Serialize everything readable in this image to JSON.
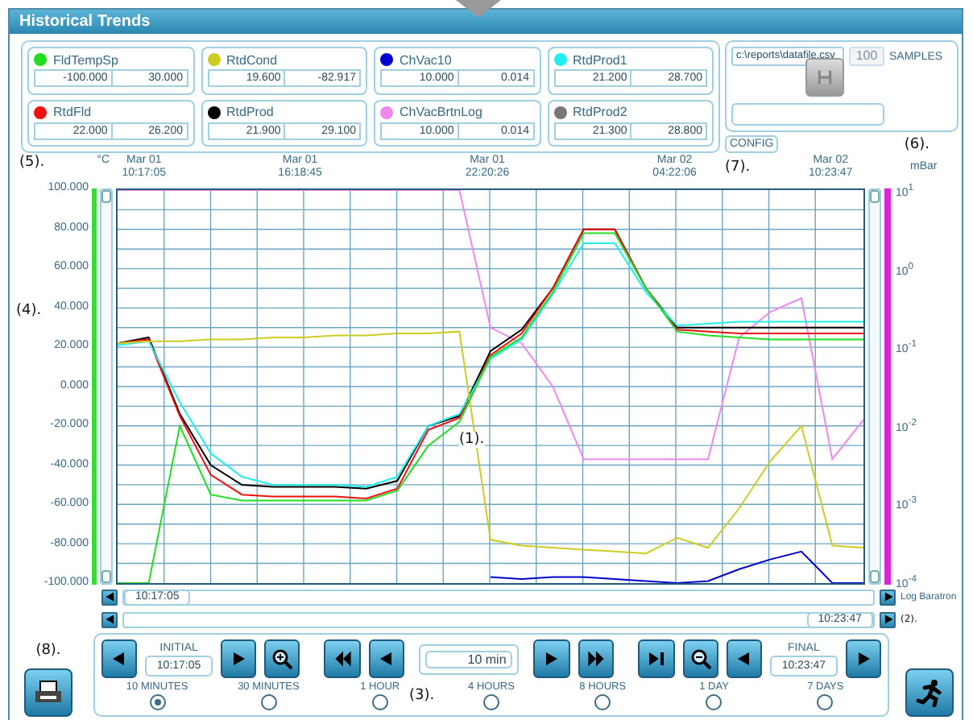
{
  "window": {
    "title": "Historical Trends"
  },
  "tags": [
    {
      "min": "-100.000",
      "max": "30.000"
    },
    {
      "min": "19.600",
      "max": "-82.917"
    },
    {
      "min": "10.000",
      "max": "0.014"
    },
    {
      "min": "21.200",
      "max": "28.700"
    },
    {
      "min": "22.000",
      "max": "26.200"
    },
    {
      "min": "21.900",
      "max": "29.100"
    },
    {
      "min": "10.000",
      "max": "0.014"
    },
    {
      "min": "21.300",
      "max": "28.800"
    }
  ],
  "export": {
    "file": "c:\\reports\\datafile.csv",
    "samples": "100",
    "samples_label": "SAMPLES",
    "samples_disabled": true,
    "save_disabled": true
  },
  "config_button": "CONFIG",
  "callouts": {
    "c1": "(1).",
    "c2": "(2).",
    "c3": "(3).",
    "c4": "(4).",
    "c5": "(5).",
    "c6": "(6).",
    "c7": "(7).",
    "c8": "(8)."
  },
  "chart": {
    "left_unit": "°C",
    "right_unit": "mBar",
    "chart_data": {
      "type": "line",
      "categories": [
        null,
        "Mar 01 10:17:05",
        null,
        null,
        null,
        null,
        "Mar 01 16:18:45",
        null,
        null,
        null,
        null,
        null,
        "Mar 01 22:20:26",
        null,
        null,
        null,
        null,
        null,
        "Mar 02 04:22:06",
        null,
        null,
        null,
        null,
        "Mar 02 10:23:47",
        null
      ],
      "ylim": [
        -100,
        100
      ],
      "grid": true,
      "yticks": [
        {
          "value": 100,
          "label": "100.000"
        },
        {
          "value": 80,
          "label": "80.000"
        },
        {
          "value": 60,
          "label": "60.000"
        },
        {
          "value": 40,
          "label": "40.000"
        },
        {
          "value": 20,
          "label": "20.000"
        },
        {
          "value": 0,
          "label": "0.000"
        },
        {
          "value": -20,
          "label": "-20.000"
        },
        {
          "value": -40,
          "label": "-40.000"
        },
        {
          "value": -60,
          "label": "-60.000"
        },
        {
          "value": -80,
          "label": "-80.000"
        },
        {
          "value": -100,
          "label": "-100.000"
        }
      ],
      "series": [
        {
          "name": "FldTempSp",
          "color": "#22dd22",
          "values": [
            -100,
            -100,
            -20,
            -55,
            -58,
            -58,
            -58,
            -58,
            -58,
            -53,
            -30,
            -18,
            15,
            25,
            48,
            78,
            78,
            50,
            28,
            26,
            25,
            24,
            24,
            24,
            24
          ]
        },
        {
          "name": "RtdCond",
          "color": "#cccc22",
          "values": [
            22,
            23,
            23,
            24,
            24,
            25,
            25,
            26,
            26,
            27,
            27,
            28,
            -78,
            -81,
            -82,
            -83,
            -84,
            -85,
            -77,
            -82,
            -62,
            -38,
            -20,
            -81,
            -82
          ]
        },
        {
          "name": "ChVac10",
          "color": "#0000cc",
          "values": [
            null,
            null,
            null,
            null,
            null,
            null,
            null,
            null,
            null,
            null,
            null,
            null,
            -97,
            -98,
            -97,
            -97,
            -98,
            -99,
            -100,
            -99,
            -93,
            -88,
            -84,
            -100,
            -100
          ]
        },
        {
          "name": "RtdProd1",
          "color": "#22eeee",
          "values": [
            21,
            23,
            -8,
            -34,
            -46,
            -50,
            -50,
            -50,
            -51,
            -46,
            -20,
            -14,
            14,
            24,
            47,
            73,
            73,
            48,
            31,
            32,
            33,
            33,
            33,
            33,
            33
          ]
        },
        {
          "name": "RtdFld",
          "color": "#ee1111",
          "values": [
            22,
            24,
            -15,
            -45,
            -55,
            -56,
            -56,
            -56,
            -57,
            -52,
            -22,
            -16,
            16,
            27,
            50,
            80,
            80,
            50,
            29,
            28,
            27,
            27,
            27,
            27,
            27
          ]
        },
        {
          "name": "RtdProd",
          "color": "#000000",
          "values": [
            22,
            25,
            -14,
            -40,
            -50,
            -51,
            -51,
            -51,
            -52,
            -48,
            -20,
            -15,
            18,
            29,
            50,
            80,
            80,
            50,
            30,
            30,
            30,
            30,
            30,
            30,
            30
          ]
        },
        {
          "name": "ChVacBrtnLog",
          "color": "#ee88ee",
          "values": [
            100,
            100,
            100,
            100,
            100,
            100,
            100,
            100,
            100,
            100,
            100,
            100,
            30,
            22,
            0,
            -37,
            -37,
            -37,
            -37,
            -37,
            25,
            38,
            45,
            -37,
            -17
          ]
        },
        {
          "name": "RtdProd2",
          "color": "#777777",
          "values": [
            null,
            null,
            null,
            null,
            null,
            null,
            null,
            null,
            null,
            null,
            null,
            null,
            null,
            null,
            null,
            null,
            null,
            null,
            null,
            null,
            null,
            null,
            null,
            null,
            null
          ]
        }
      ]
    },
    "right_ticks": [
      "10$^{1}$",
      "10$^{0}$",
      "10$^{-1}$",
      "10$^{-2}$",
      "10$^{-3}$",
      "10$^{-4}$"
    ]
  },
  "scroll": {
    "start": "10:17:05",
    "end": "10:23:47",
    "right_label": "Log Baratron"
  },
  "controls": {
    "initial_label": "INITIAL",
    "initial": "10:17:05",
    "span": "10 min",
    "final_label": "FINAL",
    "final": "10:23:47",
    "ranges": [
      {
        "label": "10 MINUTES",
        "selected": true
      },
      {
        "label": "30 MINUTES",
        "selected": false
      },
      {
        "label": "1 HOUR",
        "selected": false
      },
      {
        "label": "4 HOURS",
        "selected": false
      },
      {
        "label": "8 HOURS",
        "selected": false
      },
      {
        "label": "1 DAY",
        "selected": false
      },
      {
        "label": "7 DAYS",
        "selected": false
      }
    ]
  }
}
